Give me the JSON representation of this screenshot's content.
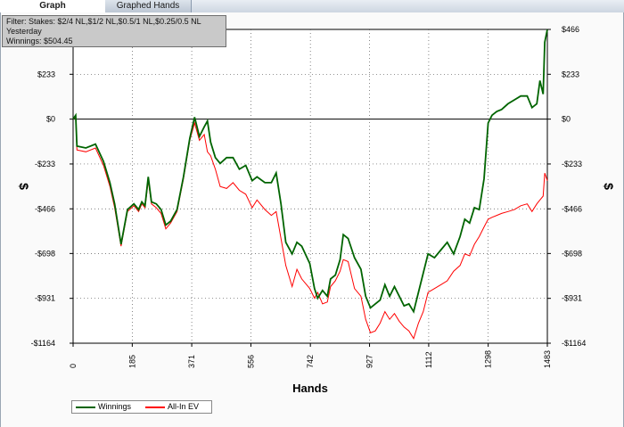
{
  "tabs": [
    {
      "label": "Graph",
      "active": true
    },
    {
      "label": "Graphed Hands",
      "active": false
    }
  ],
  "info": {
    "filter": "Filter: Stakes: $2/4 NL,$1/2 NL,$0.5/1 NL,$0.25/0.5 NL",
    "period": "Yesterday",
    "winnings": "Winnings: $504.45"
  },
  "chart_data": {
    "type": "line",
    "xlabel": "Hands",
    "ylabel": "$",
    "x_ticks": [
      0,
      185,
      371,
      556,
      742,
      927,
      1112,
      1298,
      1483
    ],
    "y_ticks": [
      466,
      233,
      0,
      -233,
      -466,
      -698,
      -931,
      -1164
    ],
    "y_tick_labels": [
      "$466",
      "$233",
      "$0",
      "-$233",
      "-$466",
      "-$698",
      "-$931",
      "-$1164"
    ],
    "xlim": [
      0,
      1483
    ],
    "ylim": [
      -1164,
      466
    ],
    "grid": true,
    "legend_position": "bottom-left",
    "series": [
      {
        "name": "Winnings",
        "color": "#006400",
        "points": [
          [
            0,
            0
          ],
          [
            8,
            20
          ],
          [
            12,
            -140
          ],
          [
            40,
            -150
          ],
          [
            70,
            -130
          ],
          [
            95,
            -220
          ],
          [
            115,
            -330
          ],
          [
            130,
            -440
          ],
          [
            150,
            -650
          ],
          [
            170,
            -470
          ],
          [
            190,
            -440
          ],
          [
            205,
            -470
          ],
          [
            215,
            -430
          ],
          [
            225,
            -450
          ],
          [
            235,
            -300
          ],
          [
            245,
            -430
          ],
          [
            260,
            -440
          ],
          [
            275,
            -470
          ],
          [
            290,
            -550
          ],
          [
            305,
            -530
          ],
          [
            325,
            -470
          ],
          [
            345,
            -300
          ],
          [
            365,
            -100
          ],
          [
            380,
            10
          ],
          [
            395,
            -90
          ],
          [
            410,
            -40
          ],
          [
            420,
            -10
          ],
          [
            430,
            -120
          ],
          [
            445,
            -200
          ],
          [
            460,
            -230
          ],
          [
            480,
            -200
          ],
          [
            500,
            -200
          ],
          [
            520,
            -260
          ],
          [
            540,
            -240
          ],
          [
            560,
            -320
          ],
          [
            575,
            -300
          ],
          [
            600,
            -330
          ],
          [
            620,
            -330
          ],
          [
            635,
            -280
          ],
          [
            650,
            -440
          ],
          [
            665,
            -640
          ],
          [
            685,
            -700
          ],
          [
            700,
            -640
          ],
          [
            715,
            -660
          ],
          [
            740,
            -750
          ],
          [
            755,
            -880
          ],
          [
            765,
            -930
          ],
          [
            780,
            -890
          ],
          [
            795,
            -920
          ],
          [
            805,
            -830
          ],
          [
            820,
            -810
          ],
          [
            835,
            -730
          ],
          [
            845,
            -600
          ],
          [
            860,
            -620
          ],
          [
            880,
            -720
          ],
          [
            900,
            -780
          ],
          [
            915,
            -920
          ],
          [
            930,
            -980
          ],
          [
            945,
            -960
          ],
          [
            960,
            -940
          ],
          [
            975,
            -860
          ],
          [
            990,
            -920
          ],
          [
            1005,
            -870
          ],
          [
            1020,
            -920
          ],
          [
            1035,
            -970
          ],
          [
            1050,
            -960
          ],
          [
            1065,
            -1000
          ],
          [
            1080,
            -900
          ],
          [
            1095,
            -800
          ],
          [
            1110,
            -700
          ],
          [
            1130,
            -720
          ],
          [
            1150,
            -680
          ],
          [
            1170,
            -640
          ],
          [
            1190,
            -700
          ],
          [
            1210,
            -610
          ],
          [
            1225,
            -520
          ],
          [
            1240,
            -540
          ],
          [
            1255,
            -460
          ],
          [
            1270,
            -470
          ],
          [
            1285,
            -310
          ],
          [
            1298,
            -20
          ],
          [
            1310,
            20
          ],
          [
            1325,
            40
          ],
          [
            1340,
            50
          ],
          [
            1360,
            80
          ],
          [
            1380,
            100
          ],
          [
            1400,
            120
          ],
          [
            1420,
            120
          ],
          [
            1435,
            60
          ],
          [
            1450,
            80
          ],
          [
            1460,
            200
          ],
          [
            1470,
            130
          ],
          [
            1475,
            400
          ],
          [
            1483,
            466
          ]
        ]
      },
      {
        "name": "All-In EV",
        "color": "#ff0000",
        "points": [
          [
            0,
            0
          ],
          [
            8,
            10
          ],
          [
            12,
            -160
          ],
          [
            40,
            -170
          ],
          [
            70,
            -150
          ],
          [
            95,
            -240
          ],
          [
            115,
            -350
          ],
          [
            130,
            -460
          ],
          [
            150,
            -660
          ],
          [
            170,
            -480
          ],
          [
            190,
            -450
          ],
          [
            205,
            -480
          ],
          [
            215,
            -440
          ],
          [
            225,
            -460
          ],
          [
            235,
            -320
          ],
          [
            245,
            -440
          ],
          [
            260,
            -460
          ],
          [
            275,
            -490
          ],
          [
            290,
            -570
          ],
          [
            305,
            -540
          ],
          [
            325,
            -480
          ],
          [
            345,
            -310
          ],
          [
            365,
            -110
          ],
          [
            380,
            -20
          ],
          [
            395,
            -110
          ],
          [
            410,
            -80
          ],
          [
            420,
            -170
          ],
          [
            430,
            -190
          ],
          [
            445,
            -260
          ],
          [
            460,
            -350
          ],
          [
            480,
            -360
          ],
          [
            500,
            -330
          ],
          [
            520,
            -370
          ],
          [
            540,
            -390
          ],
          [
            560,
            -460
          ],
          [
            575,
            -420
          ],
          [
            600,
            -470
          ],
          [
            620,
            -500
          ],
          [
            635,
            -480
          ],
          [
            650,
            -620
          ],
          [
            665,
            -760
          ],
          [
            685,
            -870
          ],
          [
            700,
            -780
          ],
          [
            715,
            -830
          ],
          [
            740,
            -880
          ],
          [
            755,
            -930
          ],
          [
            765,
            -900
          ],
          [
            780,
            -960
          ],
          [
            795,
            -950
          ],
          [
            805,
            -870
          ],
          [
            820,
            -840
          ],
          [
            835,
            -790
          ],
          [
            845,
            -730
          ],
          [
            860,
            -740
          ],
          [
            880,
            -880
          ],
          [
            900,
            -920
          ],
          [
            915,
            -1040
          ],
          [
            930,
            -1110
          ],
          [
            945,
            -1100
          ],
          [
            960,
            -1060
          ],
          [
            975,
            -1000
          ],
          [
            990,
            -1040
          ],
          [
            1005,
            -1010
          ],
          [
            1020,
            -1050
          ],
          [
            1035,
            -1080
          ],
          [
            1050,
            -1100
          ],
          [
            1065,
            -1140
          ],
          [
            1080,
            -1060
          ],
          [
            1095,
            -1000
          ],
          [
            1110,
            -900
          ],
          [
            1130,
            -880
          ],
          [
            1150,
            -860
          ],
          [
            1170,
            -840
          ],
          [
            1190,
            -790
          ],
          [
            1210,
            -760
          ],
          [
            1225,
            -700
          ],
          [
            1240,
            -710
          ],
          [
            1255,
            -650
          ],
          [
            1270,
            -610
          ],
          [
            1285,
            -560
          ],
          [
            1298,
            -520
          ],
          [
            1310,
            -510
          ],
          [
            1325,
            -500
          ],
          [
            1340,
            -490
          ],
          [
            1360,
            -480
          ],
          [
            1380,
            -470
          ],
          [
            1400,
            -450
          ],
          [
            1420,
            -440
          ],
          [
            1435,
            -480
          ],
          [
            1450,
            -440
          ],
          [
            1460,
            -420
          ],
          [
            1470,
            -400
          ],
          [
            1475,
            -280
          ],
          [
            1483,
            -320
          ]
        ]
      }
    ]
  }
}
